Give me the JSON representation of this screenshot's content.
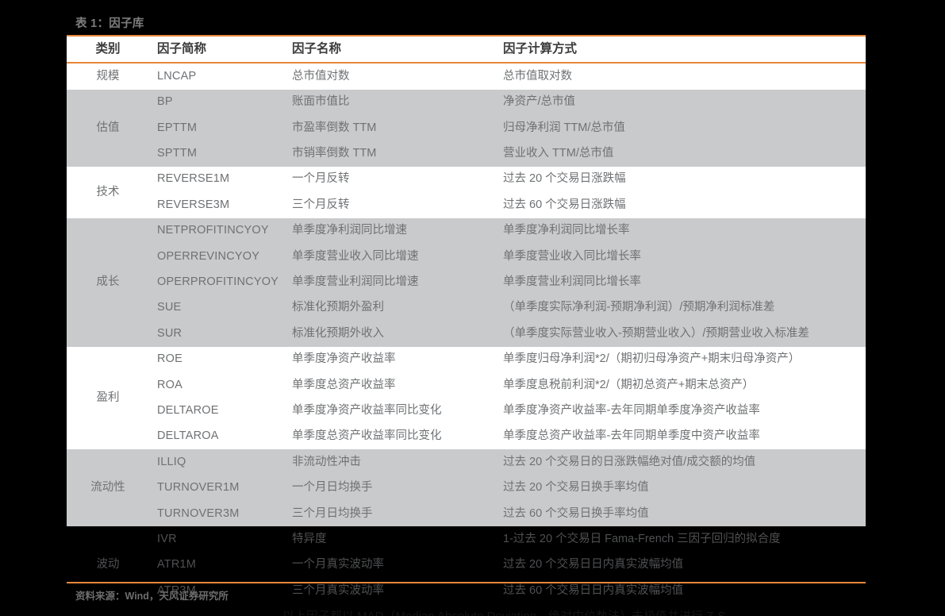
{
  "caption": "表 1：因子库",
  "colors": {
    "rule": "#e8873a",
    "band_white": "#ffffff",
    "band_gray": "#c9cacb",
    "page_background": "#000000",
    "text": "#6f7173",
    "header_text": "#3c3c3c"
  },
  "table": {
    "headers": {
      "category": "类别",
      "abbr": "因子简称",
      "name": "因子名称",
      "calc": "因子计算方式"
    },
    "sections": [
      {
        "category": "规模",
        "band": "white",
        "rows": [
          {
            "abbr": "LNCAP",
            "name": "总市值对数",
            "calc": "总市值取对数"
          }
        ]
      },
      {
        "category": "估值",
        "band": "gray",
        "rows": [
          {
            "abbr": "BP",
            "name": "账面市值比",
            "calc": "净资产/总市值"
          },
          {
            "abbr": "EPTTM",
            "name": "市盈率倒数 TTM",
            "calc": "归母净利润 TTM/总市值"
          },
          {
            "abbr": "SPTTM",
            "name": "市销率倒数 TTM",
            "calc": "营业收入 TTM/总市值"
          }
        ]
      },
      {
        "category": "技术",
        "band": "white",
        "rows": [
          {
            "abbr": "REVERSE1M",
            "name": "一个月反转",
            "calc": "过去 20 个交易日涨跌幅"
          },
          {
            "abbr": "REVERSE3M",
            "name": "三个月反转",
            "calc": "过去 60 个交易日涨跌幅"
          }
        ]
      },
      {
        "category": "成长",
        "band": "gray",
        "rows": [
          {
            "abbr": "NETPROFITINCYOY",
            "name": "单季度净利润同比增速",
            "calc": "单季度净利润同比增长率"
          },
          {
            "abbr": "OPERREVINCYOY",
            "name": "单季度营业收入同比增速",
            "calc": "单季度营业收入同比增长率"
          },
          {
            "abbr": "OPERPROFITINCYOY",
            "name": "单季度营业利润同比增速",
            "calc": "单季度营业利润同比增长率"
          },
          {
            "abbr": "SUE",
            "name": "标准化预期外盈利",
            "calc": "（单季度实际净利润-预期净利润）/预期净利润标准差"
          },
          {
            "abbr": "SUR",
            "name": "标准化预期外收入",
            "calc": "（单季度实际营业收入-预期营业收入）/预期营业收入标准差"
          }
        ]
      },
      {
        "category": "盈利",
        "band": "white",
        "rows": [
          {
            "abbr": "ROE",
            "name": "单季度净资产收益率",
            "calc": "单季度归母净利润*2/（期初归母净资产+期末归母净资产）"
          },
          {
            "abbr": "ROA",
            "name": "单季度总资产收益率",
            "calc": "单季度息税前利润*2/（期初总资产+期末总资产）"
          },
          {
            "abbr": "DELTAROE",
            "name": "单季度净资产收益率同比变化",
            "calc": "单季度净资产收益率-去年同期单季度净资产收益率"
          },
          {
            "abbr": "DELTAROA",
            "name": "单季度总资产收益率同比变化",
            "calc": "单季度总资产收益率-去年同期单季度中资产收益率"
          }
        ]
      },
      {
        "category": "流动性",
        "band": "gray",
        "rows": [
          {
            "abbr": "ILLIQ",
            "name": "非流动性冲击",
            "calc": "过去 20 个交易日的日涨跌幅绝对值/成交额的均值"
          },
          {
            "abbr": "TURNOVER1M",
            "name": "一个月日均换手",
            "calc": "过去 20 个交易日换手率均值"
          },
          {
            "abbr": "TURNOVER3M",
            "name": "三个月日均换手",
            "calc": "过去 60 个交易日换手率均值"
          }
        ]
      },
      {
        "category": "波动",
        "band": "black",
        "rows": [
          {
            "abbr": "IVR",
            "name": "特异度",
            "calc": "1-过去 20 个交易日 Fama-French 三因子回归的拟合度"
          },
          {
            "abbr": "ATR1M",
            "name": "一个月真实波动率",
            "calc": "过去 20 个交易日日内真实波幅均值"
          },
          {
            "abbr": "ATR3M",
            "name": "三个月真实波动率",
            "calc": "过去 60 个交易日日内真实波幅均值"
          }
        ]
      }
    ]
  },
  "source": "资料来源：Wind，天风证券研究所",
  "clipped_note": "以上因子都以 MAD（Median Absolute Deviation，绝对中位数法）去极值并进行 Z-S"
}
